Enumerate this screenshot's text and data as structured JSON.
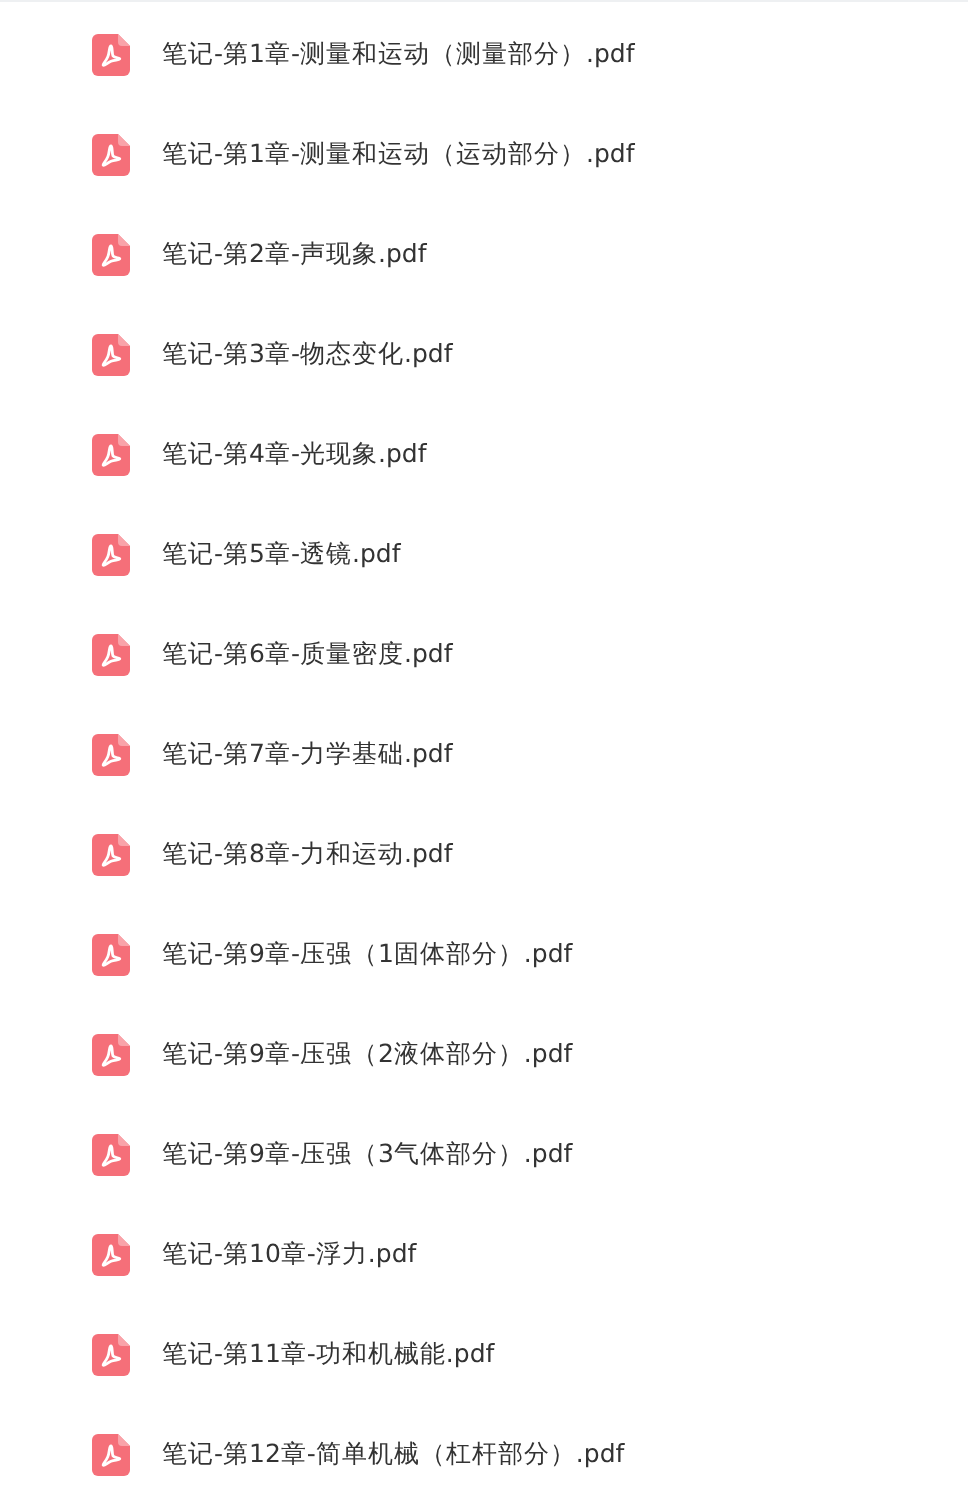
{
  "files": [
    {
      "name": "笔记-第1章-测量和运动（测量部分）.pdf"
    },
    {
      "name": "笔记-第1章-测量和运动（运动部分）.pdf"
    },
    {
      "name": "笔记-第2章-声现象.pdf"
    },
    {
      "name": "笔记-第3章-物态变化.pdf"
    },
    {
      "name": "笔记-第4章-光现象.pdf"
    },
    {
      "name": "笔记-第5章-透镜.pdf"
    },
    {
      "name": "笔记-第6章-质量密度.pdf"
    },
    {
      "name": "笔记-第7章-力学基础.pdf"
    },
    {
      "name": "笔记-第8章-力和运动.pdf"
    },
    {
      "name": "笔记-第9章-压强（1固体部分）.pdf"
    },
    {
      "name": "笔记-第9章-压强（2液体部分）.pdf"
    },
    {
      "name": "笔记-第9章-压强（3气体部分）.pdf"
    },
    {
      "name": "笔记-第10章-浮力.pdf"
    },
    {
      "name": "笔记-第11章-功和机械能.pdf"
    },
    {
      "name": "笔记-第12章-简单机械（杠杆部分）.pdf"
    }
  ]
}
